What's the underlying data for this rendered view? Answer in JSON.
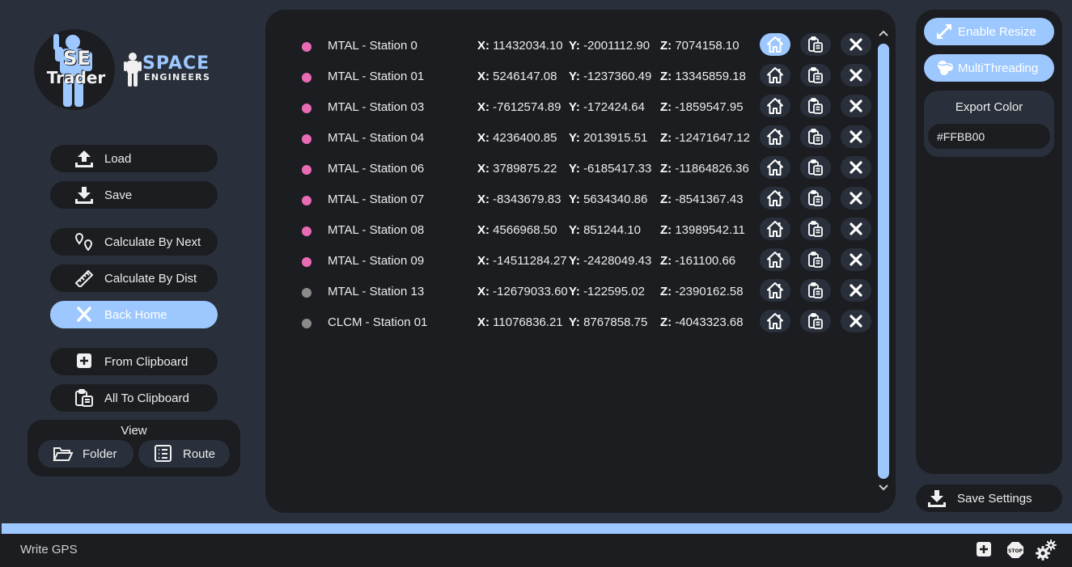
{
  "logo": {
    "line1": "SE",
    "line2": "Trader"
  },
  "brand": {
    "line1": "SPACE",
    "line2": "ENGINEERS"
  },
  "left_buttons": {
    "load": "Load",
    "save": "Save",
    "calc_next": "Calculate By Next",
    "calc_dist": "Calculate By Dist",
    "back_home": "Back Home",
    "from_clipboard": "From Clipboard",
    "all_to_clipboard": "All To Clipboard"
  },
  "view": {
    "title": "View",
    "folder": "Folder",
    "route": "Route"
  },
  "stations": [
    {
      "name": "MTAL - Station 0",
      "x": "11432034.10",
      "y": "-2001112.90",
      "z": "7074158.10",
      "color": "#e96bb4",
      "home_active": true
    },
    {
      "name": "MTAL - Station 01",
      "x": "5246147.08",
      "y": "-1237360.49",
      "z": "13345859.18",
      "color": "#e96bb4",
      "home_active": false
    },
    {
      "name": "MTAL - Station 03",
      "x": "-7612574.89",
      "y": "-172424.64",
      "z": "-1859547.95",
      "color": "#e96bb4",
      "home_active": false
    },
    {
      "name": "MTAL - Station 04",
      "x": "4236400.85",
      "y": "2013915.51",
      "z": "-12471647.12",
      "color": "#e96bb4",
      "home_active": false
    },
    {
      "name": "MTAL - Station 06",
      "x": "3789875.22",
      "y": "-6185417.33",
      "z": "-11864826.36",
      "color": "#e96bb4",
      "home_active": false
    },
    {
      "name": "MTAL - Station 07",
      "x": "-8343679.83",
      "y": "5634340.86",
      "z": "-8541367.43",
      "color": "#e96bb4",
      "home_active": false
    },
    {
      "name": "MTAL - Station 08",
      "x": "4566968.50",
      "y": "851244.10",
      "z": "13989542.11",
      "color": "#e96bb4",
      "home_active": false
    },
    {
      "name": "MTAL - Station 09",
      "x": "-14511284.27",
      "y": "-2428049.43",
      "z": "-161100.66",
      "color": "#e96bb4",
      "home_active": false
    },
    {
      "name": "MTAL - Station 13",
      "x": "-12679033.60",
      "y": "-122595.02",
      "z": "-2390162.58",
      "color": "#8a8a8a",
      "home_active": false
    },
    {
      "name": "CLCM - Station 01",
      "x": "11076836.21",
      "y": "8767858.75",
      "z": "-4043323.68",
      "color": "#8a8a8a",
      "home_active": false
    }
  ],
  "coord_labels": {
    "x": "X:",
    "y": "Y:",
    "z": "Z:"
  },
  "right_panel": {
    "enable_resize": "Enable Resize",
    "multithreading": "MultiThreading",
    "export_color_title": "Export Color",
    "export_color_value": "#FFBB00",
    "save_settings": "Save Settings"
  },
  "status": {
    "text": "Write GPS"
  },
  "colors": {
    "accent": "#9dc8ff",
    "panel": "#1b1d21",
    "background": "#2a303b",
    "dot_active": "#e96bb4",
    "dot_inactive": "#8a8a8a"
  }
}
